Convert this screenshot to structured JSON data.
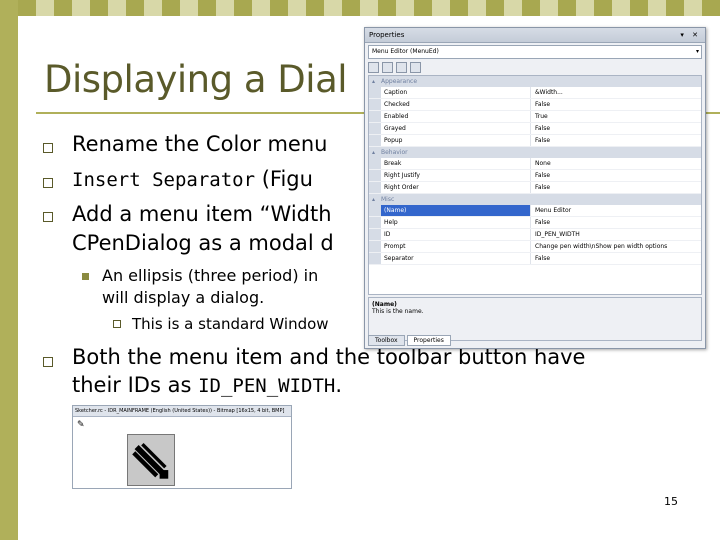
{
  "slide": {
    "title": "Displaying a Dial",
    "page_number": "15",
    "colors": {
      "accent": "#b0b05a",
      "title": "#5a5a2a",
      "checker_dark": "#a8a850",
      "checker_light": "#d8d8a8"
    },
    "bullets": [
      {
        "text": "Rename the Color menu"
      },
      {
        "code": "Insert Separator",
        "text": " (Figu"
      },
      {
        "text_line1": "Add a menu item “Width",
        "text_line2": "CPenDialog as a modal d"
      },
      {
        "sub": "An ellipsis (three period) in",
        "sub2": "will display a dialog."
      },
      {
        "subsub": "This is a standard Window"
      },
      {
        "text_line1": "Both the menu item and the toolbar button have",
        "text_line2_pre": "their IDs as ",
        "code": "ID_PEN_WIDTH",
        "text_line2_post": "."
      }
    ]
  },
  "properties_panel": {
    "title": "Properties",
    "title_controls": "▾ ✕",
    "object_combo": "Menu Editor  (MenuEd)",
    "categories": [
      {
        "name": "Appearance",
        "rows": [
          {
            "name": "Caption",
            "value": "&Width..."
          },
          {
            "name": "Checked",
            "value": "False"
          },
          {
            "name": "Enabled",
            "value": "True"
          },
          {
            "name": "Grayed",
            "value": "False"
          },
          {
            "name": "Popup",
            "value": "False"
          }
        ]
      },
      {
        "name": "Behavior",
        "rows": [
          {
            "name": "Break",
            "value": "None"
          },
          {
            "name": "Right Justify",
            "value": "False"
          },
          {
            "name": "Right Order",
            "value": "False"
          }
        ]
      },
      {
        "name": "Misc",
        "rows": [
          {
            "name": "(Name)",
            "value": "Menu Editor",
            "selected": true
          },
          {
            "name": "Help",
            "value": "False"
          },
          {
            "name": "ID",
            "value": "ID_PEN_WIDTH"
          },
          {
            "name": "Prompt",
            "value": "Change pen width\\nShow pen width options"
          },
          {
            "name": "Separator",
            "value": "False"
          }
        ]
      }
    ],
    "description_title": "(Name)",
    "description_text": "This is the name.",
    "tabs": [
      "Toolbox",
      "Properties"
    ]
  },
  "bitmap_editor": {
    "title": "Sketcher.rc - IDR_MAINFRAME (English (United States)) - Bitmap [16x15, 4 bit, BMP]"
  }
}
